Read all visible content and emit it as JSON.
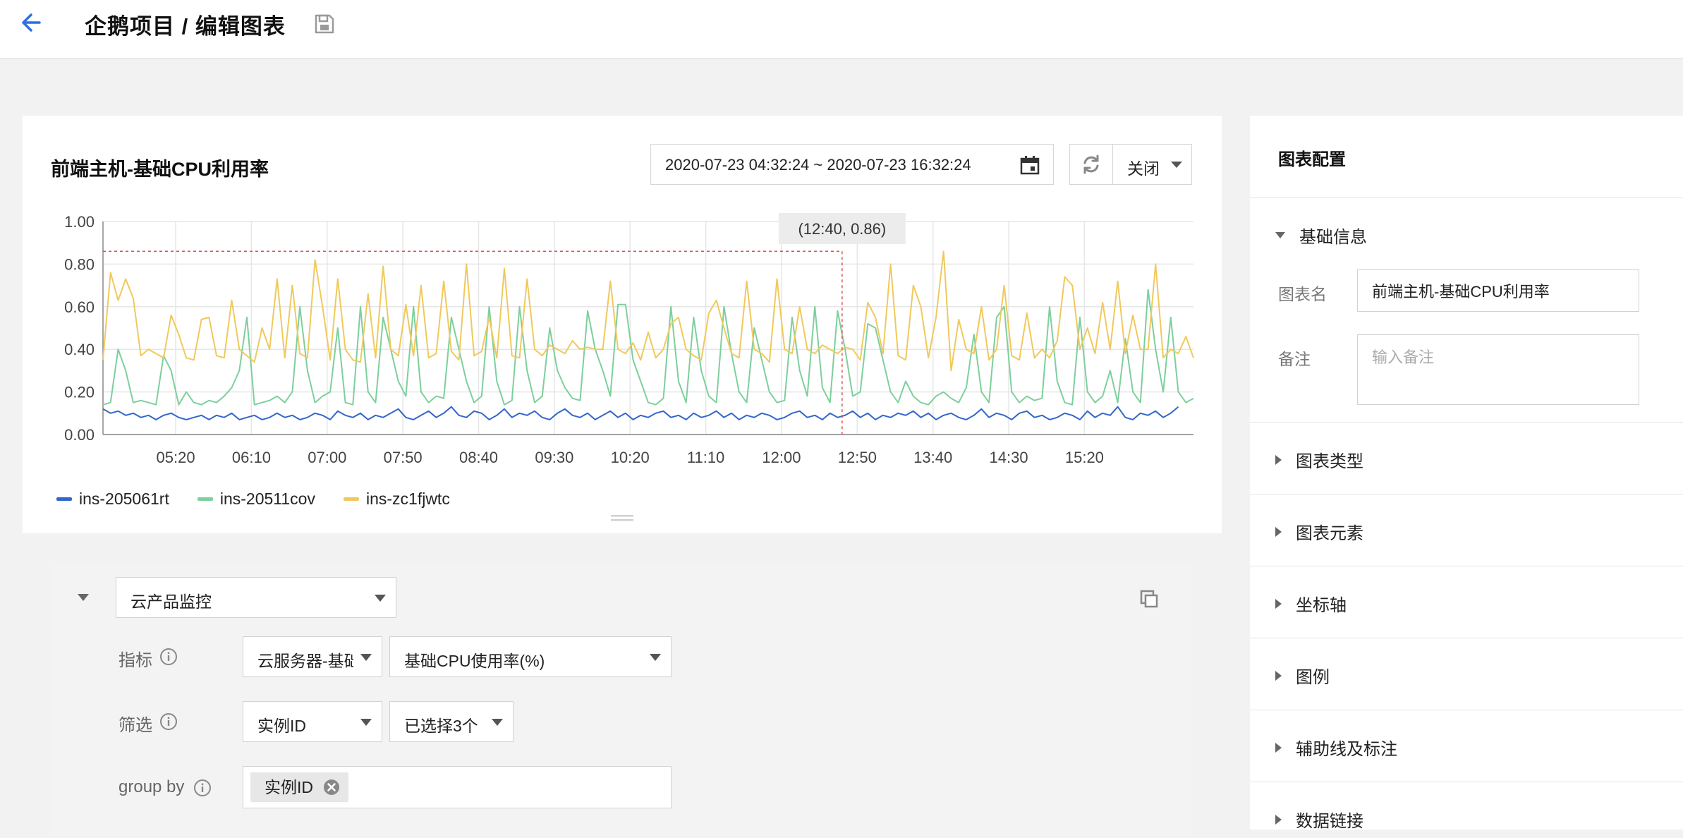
{
  "header": {
    "title": "企鹅项目 / 编辑图表"
  },
  "chart_card": {
    "title": "前端主机-基础CPU利用率",
    "time_range": "2020-07-23 04:32:24 ~ 2020-07-23 16:32:24",
    "refresh_label": "关闭"
  },
  "chart_data": {
    "type": "line",
    "title": "前端主机-基础CPU利用率",
    "xlabel": "",
    "ylabel": "",
    "ylim": [
      0,
      1
    ],
    "y_ticks": [
      "0.00",
      "0.20",
      "0.40",
      "0.60",
      "0.80",
      "1.00"
    ],
    "x_tick_labels": [
      "05:20",
      "06:10",
      "07:00",
      "07:50",
      "08:40",
      "09:30",
      "10:20",
      "11:10",
      "12:00",
      "12:50",
      "13:40",
      "14:30",
      "15:20"
    ],
    "x_range": [
      "04:32",
      "16:32"
    ],
    "point_interval_minutes": 5,
    "grid": true,
    "legend_position": "bottom-left",
    "tooltip": {
      "label": "(12:40, 0.86)",
      "x": "12:40",
      "y": 0.86
    },
    "series": [
      {
        "name": "ins-205061rt",
        "color": "#3366cc",
        "values": [
          0.12,
          0.1,
          0.11,
          0.09,
          0.1,
          0.08,
          0.09,
          0.07,
          0.09,
          0.1,
          0.08,
          0.07,
          0.08,
          0.09,
          0.07,
          0.09,
          0.08,
          0.1,
          0.07,
          0.08,
          0.09,
          0.07,
          0.08,
          0.1,
          0.08,
          0.09,
          0.07,
          0.08,
          0.1,
          0.09,
          0.07,
          0.11,
          0.09,
          0.08,
          0.1,
          0.07,
          0.09,
          0.08,
          0.1,
          0.12,
          0.08,
          0.07,
          0.09,
          0.11,
          0.08,
          0.1,
          0.13,
          0.09,
          0.08,
          0.11,
          0.1,
          0.07,
          0.09,
          0.12,
          0.08,
          0.1,
          0.09,
          0.11,
          0.08,
          0.07,
          0.1,
          0.12,
          0.09,
          0.08,
          0.1,
          0.07,
          0.09,
          0.11,
          0.08,
          0.1,
          0.07,
          0.09,
          0.08,
          0.1,
          0.11,
          0.08,
          0.09,
          0.07,
          0.1,
          0.08,
          0.09,
          0.11,
          0.08,
          0.1,
          0.07,
          0.09,
          0.08,
          0.1,
          0.09,
          0.07,
          0.08,
          0.1,
          0.11,
          0.08,
          0.09,
          0.07,
          0.1,
          0.08,
          0.09,
          0.11,
          0.08,
          0.1,
          0.07,
          0.09,
          0.08,
          0.1,
          0.09,
          0.11,
          0.08,
          0.1,
          0.07,
          0.09,
          0.1,
          0.08,
          0.07,
          0.09,
          0.12,
          0.08,
          0.1,
          0.09,
          0.07,
          0.1,
          0.11,
          0.08,
          0.09,
          0.07,
          0.08,
          0.1,
          0.09,
          0.07,
          0.11,
          0.08,
          0.1,
          0.09,
          0.13,
          0.08,
          0.07,
          0.1,
          0.09,
          0.11,
          0.08,
          0.1,
          0.13
        ]
      },
      {
        "name": "ins-20511cov",
        "color": "#7dcf9c",
        "values": [
          0.14,
          0.15,
          0.4,
          0.3,
          0.15,
          0.16,
          0.15,
          0.14,
          0.37,
          0.3,
          0.14,
          0.2,
          0.15,
          0.14,
          0.16,
          0.15,
          0.18,
          0.22,
          0.3,
          0.55,
          0.14,
          0.15,
          0.16,
          0.18,
          0.15,
          0.2,
          0.6,
          0.3,
          0.15,
          0.18,
          0.2,
          0.5,
          0.15,
          0.14,
          0.6,
          0.2,
          0.15,
          0.55,
          0.4,
          0.25,
          0.18,
          0.6,
          0.2,
          0.15,
          0.18,
          0.17,
          0.55,
          0.4,
          0.25,
          0.15,
          0.18,
          0.6,
          0.25,
          0.14,
          0.16,
          0.6,
          0.3,
          0.15,
          0.18,
          0.5,
          0.3,
          0.22,
          0.17,
          0.16,
          0.58,
          0.4,
          0.3,
          0.18,
          0.61,
          0.61,
          0.35,
          0.25,
          0.15,
          0.14,
          0.17,
          0.6,
          0.25,
          0.15,
          0.55,
          0.3,
          0.18,
          0.15,
          0.6,
          0.38,
          0.2,
          0.15,
          0.5,
          0.35,
          0.2,
          0.15,
          0.16,
          0.55,
          0.3,
          0.18,
          0.6,
          0.22,
          0.15,
          0.58,
          0.4,
          0.18,
          0.2,
          0.52,
          0.5,
          0.35,
          0.2,
          0.15,
          0.25,
          0.18,
          0.15,
          0.14,
          0.18,
          0.2,
          0.17,
          0.15,
          0.22,
          0.47,
          0.2,
          0.15,
          0.55,
          0.6,
          0.2,
          0.15,
          0.18,
          0.16,
          0.17,
          0.6,
          0.25,
          0.15,
          0.14,
          0.55,
          0.2,
          0.15,
          0.18,
          0.3,
          0.15,
          0.45,
          0.2,
          0.15,
          0.68,
          0.4,
          0.2,
          0.55,
          0.2,
          0.15,
          0.17,
          0.18
        ]
      },
      {
        "name": "ins-zc1fjwtc",
        "color": "#f0c95c",
        "values": [
          0.35,
          0.76,
          0.63,
          0.73,
          0.64,
          0.37,
          0.4,
          0.38,
          0.36,
          0.56,
          0.47,
          0.36,
          0.35,
          0.54,
          0.55,
          0.37,
          0.36,
          0.63,
          0.4,
          0.37,
          0.34,
          0.5,
          0.4,
          0.73,
          0.36,
          0.7,
          0.38,
          0.36,
          0.82,
          0.6,
          0.35,
          0.73,
          0.4,
          0.35,
          0.34,
          0.66,
          0.36,
          0.79,
          0.4,
          0.37,
          0.61,
          0.37,
          0.7,
          0.36,
          0.38,
          0.72,
          0.39,
          0.35,
          0.8,
          0.37,
          0.39,
          0.55,
          0.36,
          0.78,
          0.37,
          0.36,
          0.73,
          0.4,
          0.37,
          0.42,
          0.4,
          0.38,
          0.44,
          0.4,
          0.41,
          0.4,
          0.4,
          0.72,
          0.4,
          0.38,
          0.43,
          0.35,
          0.48,
          0.36,
          0.4,
          0.52,
          0.55,
          0.4,
          0.37,
          0.35,
          0.57,
          0.63,
          0.5,
          0.38,
          0.36,
          0.72,
          0.4,
          0.38,
          0.34,
          0.73,
          0.4,
          0.38,
          0.6,
          0.4,
          0.38,
          0.42,
          0.4,
          0.38,
          0.41,
          0.4,
          0.35,
          0.62,
          0.55,
          0.38,
          0.8,
          0.37,
          0.35,
          0.7,
          0.6,
          0.36,
          0.55,
          0.86,
          0.3,
          0.54,
          0.4,
          0.38,
          0.6,
          0.35,
          0.4,
          0.7,
          0.37,
          0.35,
          0.57,
          0.36,
          0.4,
          0.36,
          0.44,
          0.74,
          0.7,
          0.4,
          0.5,
          0.38,
          0.62,
          0.4,
          0.72,
          0.38,
          0.56,
          0.4,
          0.4,
          0.8,
          0.36,
          0.4,
          0.38,
          0.46,
          0.36,
          0.4,
          0.35,
          0.38,
          0.44,
          0.35,
          0.4,
          0.5,
          0.38,
          0.33,
          0.44,
          0.34,
          0.38,
          0.55,
          0.38,
          0.44,
          0.33,
          0.58,
          0.38,
          0.34,
          0.38,
          0.59,
          0.34,
          0.35
        ]
      }
    ]
  },
  "query": {
    "source_value": "云产品监控",
    "metric_label": "指标",
    "metric_product_value": "云服务器-基础监控",
    "metric_value": "基础CPU使用率(%)",
    "filter_label": "筛选",
    "filter_key_value": "实例ID",
    "filter_value": "已选择3个",
    "groupby_label": "group by",
    "groupby_tag": "实例ID"
  },
  "config": {
    "title": "图表配置",
    "basic_section": "基础信息",
    "chart_name_label": "图表名",
    "chart_name_value": "前端主机-基础CPU利用率",
    "remark_label": "备注",
    "remark_placeholder": "输入备注",
    "sections": [
      "图表类型",
      "图表元素",
      "坐标轴",
      "图例",
      "辅助线及标注",
      "数据链接"
    ]
  },
  "colors": {
    "accent": "#2f6fe0",
    "series_blue": "#3366cc",
    "series_green": "#7dcf9c",
    "series_yellow": "#f0c95c",
    "guide_line": "#d9534f"
  },
  "icons": [
    "back-arrow-icon",
    "save-icon",
    "calendar-icon",
    "refresh-icon",
    "copy-icon",
    "info-icon",
    "close-circle-icon",
    "chevron-down-icon",
    "triangle-right-icon"
  ]
}
